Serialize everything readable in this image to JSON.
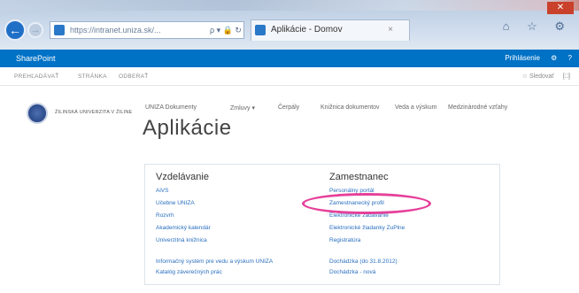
{
  "browser": {
    "url": "https://intranet.uniza.sk/...",
    "addr_controls": "ρ ▾ 🔒 ↻",
    "tab_title": "Aplikácie - Domov",
    "tab_close": "×",
    "chrome_icons": "⌂ ☆ ⚙",
    "close": "✕"
  },
  "suitebar": {
    "brand": "SharePoint",
    "user": "Prihlásenie",
    "gear": "⚙",
    "help": "?"
  },
  "ribbon": {
    "items": [
      "PREHĽADÁVAŤ",
      "STRÁNKA",
      "ODBERAŤ"
    ],
    "share": "☆ Sledovať",
    "sync": "[□]"
  },
  "site": {
    "logo_text": "ŽILINSKÁ UNIVERZITA V ŽILINE",
    "nav": [
      "UNIZA Dokumenty",
      "Zmluvy ▾",
      "Čerpály",
      "Knižnica dokumentov",
      "Veda a výskum",
      "Medzinárodné vzťahy"
    ],
    "title": "Aplikácie"
  },
  "vzdelavanie": {
    "heading": "Vzdelávanie",
    "links": [
      "AiVS",
      "Učebne UNIZA",
      "Rozvrh",
      "Akademický kalendár",
      "Univerzitná knižnica"
    ],
    "links2": [
      "Informačný systém pre vedu a výskum UNIZA",
      "Katalóg záverečných prác"
    ]
  },
  "zamestnanec": {
    "heading": "Zamestnanec",
    "links": [
      "Personálny portál",
      "Zamestnanecký profil",
      "Elektronické zadávanie",
      "Elektronické žiadanky ZuPlne",
      "Registratúra"
    ],
    "links2": [
      "Dochádzka (do 31.8.2012)",
      "Dochádzka - nová"
    ]
  },
  "colors": {
    "suitebar": "#0072c6",
    "link": "#2a6fbf",
    "highlight": "#e6409a"
  }
}
